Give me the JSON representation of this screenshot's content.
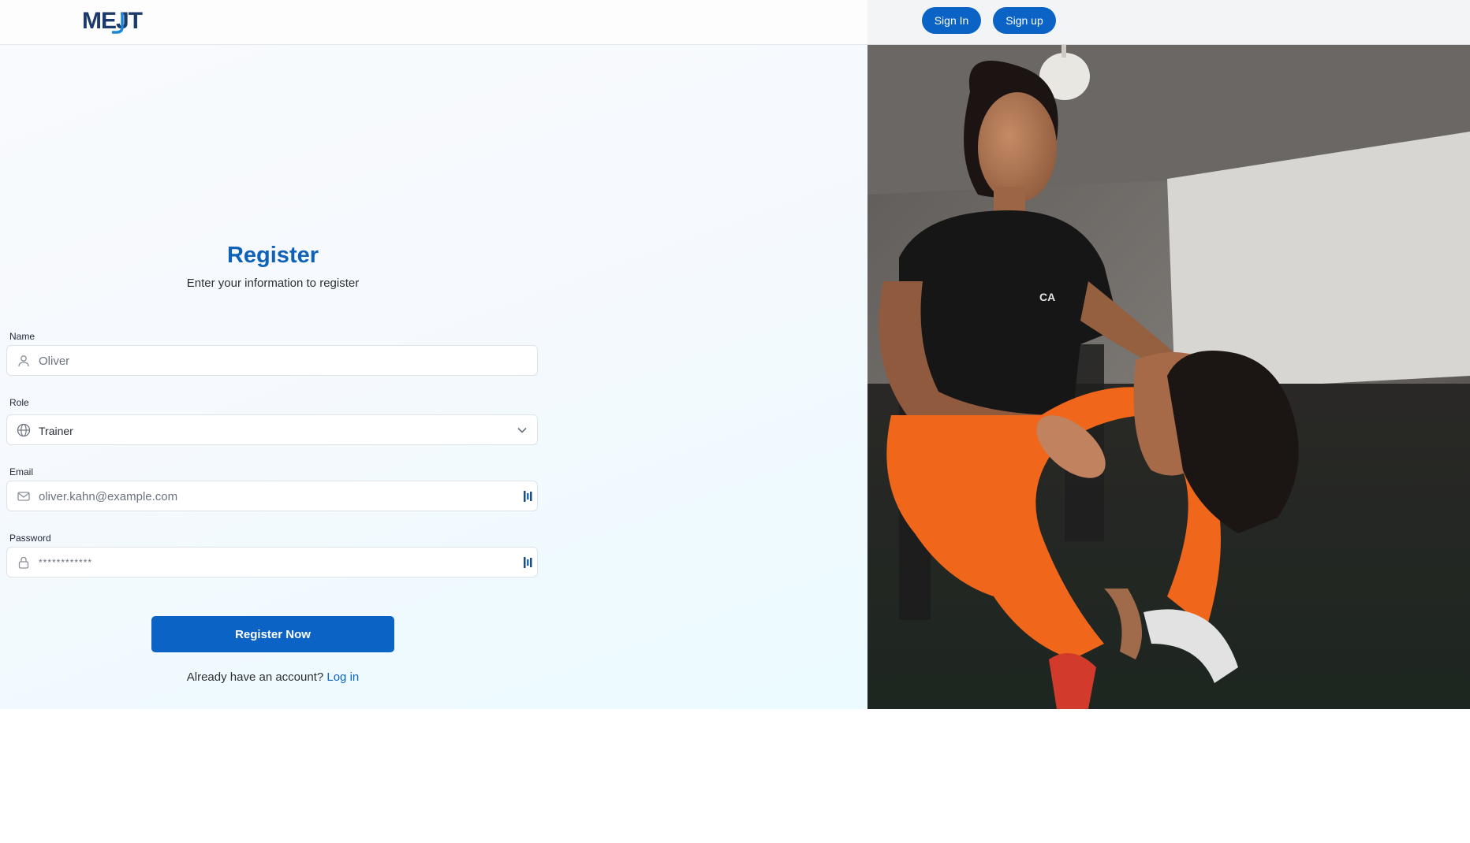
{
  "brand": {
    "logo_text": "MEJT"
  },
  "header": {
    "sign_in_label": "Sign In",
    "sign_up_label": "Sign up"
  },
  "form": {
    "title": "Register",
    "subtitle": "Enter your information to register",
    "name": {
      "label": "Name",
      "placeholder": "Oliver"
    },
    "role": {
      "label": "Role",
      "value": "Trainer"
    },
    "email": {
      "label": "Email",
      "placeholder": "oliver.kahn@example.com"
    },
    "password": {
      "label": "Password",
      "placeholder": "************"
    },
    "submit_label": "Register Now",
    "login_prompt": "Already have an account?",
    "login_link": "Log in"
  },
  "colors": {
    "accent": "#0b63c5",
    "title": "#0e62b8"
  },
  "icons": [
    "user-icon",
    "globe-icon",
    "chevron-down-icon",
    "mail-icon",
    "lock-icon",
    "password-manager-icon"
  ]
}
